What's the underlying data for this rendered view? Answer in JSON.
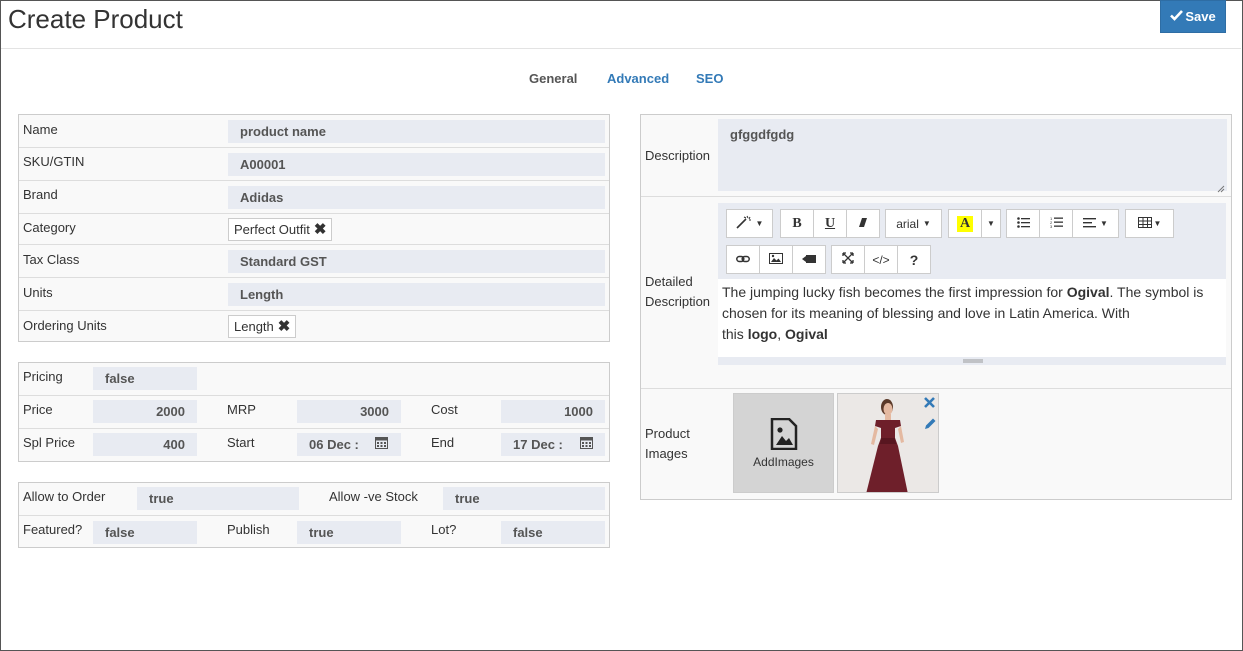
{
  "header": {
    "title": "Create Product",
    "save_label": "Save"
  },
  "tabs": [
    {
      "label": "General",
      "active": false
    },
    {
      "label": "Advanced",
      "active": true
    },
    {
      "label": "SEO",
      "active": true
    }
  ],
  "product": {
    "name_label": "Name",
    "name_placeholder": "product name",
    "sku_label": "SKU/GTIN",
    "sku_value": "A00001",
    "brand_label": "Brand",
    "brand_value": "Adidas",
    "category_label": "Category",
    "category_chip": "Perfect Outfit",
    "tax_label": "Tax Class",
    "tax_value": "Standard GST",
    "units_label": "Units",
    "units_value": "Length",
    "ordering_label": "Ordering Units",
    "ordering_chip": "Length"
  },
  "pricing": {
    "pricing_label": "Pricing",
    "pricing_value": "false",
    "price_label": "Price",
    "price_value": "2000",
    "mrp_label": "MRP",
    "mrp_value": "3000",
    "cost_label": "Cost",
    "cost_value": "1000",
    "spl_label": "Spl Price",
    "spl_value": "400",
    "start_label": "Start",
    "start_value": "06 Dec :",
    "end_label": "End",
    "end_value": "17 Dec :"
  },
  "flags": {
    "allow_order_label": "Allow to Order",
    "allow_order_value": "true",
    "allow_neg_label": "Allow -ve Stock",
    "allow_neg_value": "true",
    "featured_label": "Featured?",
    "featured_value": "false",
    "publish_label": "Publish",
    "publish_value": "true",
    "lot_label": "Lot?",
    "lot_value": "false"
  },
  "description": {
    "label": "Description",
    "value": "gfggdfgdg",
    "detailed_label_1": "Detailed",
    "detailed_label_2": "Description",
    "toolbar": {
      "font_name": "arial",
      "highlight_letter": "A",
      "bold": "B",
      "underline": "U",
      "help": "?",
      "code": "</>"
    },
    "body": {
      "t1": "The jumping lucky fish becomes the first impression for ",
      "b1": "Ogival",
      "t2": ". The symbol is chosen for its meaning of blessing and love in Latin America. With",
      "t3": "this ",
      "b2": "logo",
      "t4": ", ",
      "b3": "Ogival"
    }
  },
  "images": {
    "label_1": "Product",
    "label_2": "Images",
    "add_label": "AddImages"
  },
  "colors": {
    "accent": "#337ab7",
    "field_bg": "#e8ebf2",
    "highlight": "#ffff00",
    "dress": "#6e1f2a"
  },
  "icons": [
    "check-icon",
    "calendar-icon",
    "magic-wand-icon",
    "eraser-icon",
    "unordered-list-icon",
    "ordered-list-icon",
    "align-icon",
    "table-icon",
    "link-icon",
    "picture-icon",
    "video-icon",
    "fullscreen-icon",
    "image-icon",
    "close-icon",
    "pencil-icon"
  ]
}
